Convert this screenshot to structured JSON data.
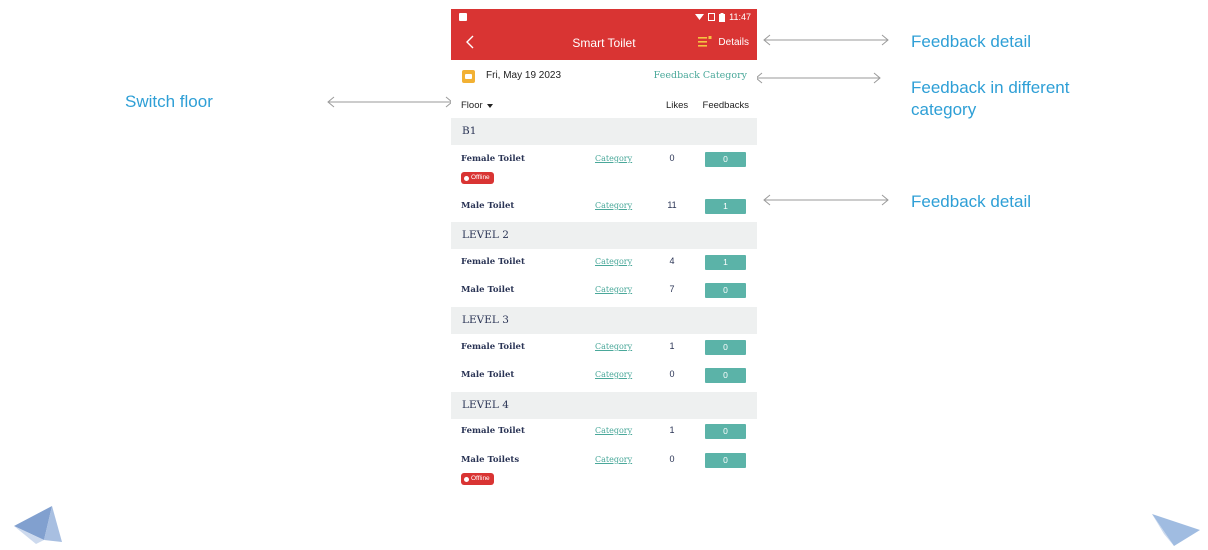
{
  "annotations": {
    "switch_floor": "Switch floor",
    "feedback_detail_top": "Feedback detail",
    "feedback_category": "Feedback in different category",
    "feedback_detail_row": "Feedback detail"
  },
  "status_bar": {
    "time": "11:47"
  },
  "app_bar": {
    "title": "Smart Toilet",
    "details_label": "Details"
  },
  "date_bar": {
    "date": "Fri, May 19 2023",
    "feedback_category_link": "Feedback Category"
  },
  "table_header": {
    "floor_label": "Floor",
    "likes_label": "Likes",
    "feedbacks_label": "Feedbacks"
  },
  "floors": [
    {
      "name": "B1",
      "toilets": [
        {
          "name": "Female Toilet",
          "category": "Category",
          "likes": "0",
          "feedbacks": "0",
          "badge": "Offline"
        },
        {
          "name": "Male Toilet",
          "category": "Category",
          "likes": "11",
          "feedbacks": "1"
        }
      ]
    },
    {
      "name": "LEVEL 2",
      "toilets": [
        {
          "name": "Female Toilet",
          "category": "Category",
          "likes": "4",
          "feedbacks": "1"
        },
        {
          "name": "Male Toilet",
          "category": "Category",
          "likes": "7",
          "feedbacks": "0"
        }
      ]
    },
    {
      "name": "LEVEL 3",
      "toilets": [
        {
          "name": "Female Toilet",
          "category": "Category",
          "likes": "1",
          "feedbacks": "0"
        },
        {
          "name": "Male Toilet",
          "category": "Category",
          "likes": "0",
          "feedbacks": "0"
        }
      ]
    },
    {
      "name": "LEVEL 4",
      "toilets": [
        {
          "name": "Female Toilet",
          "category": "Category",
          "likes": "1",
          "feedbacks": "0"
        },
        {
          "name": "Male Toilets",
          "category": "Category",
          "likes": "0",
          "feedbacks": "0",
          "badge": "Offline"
        }
      ]
    }
  ],
  "colors": {
    "app_bar": "#d93433",
    "accent": "#4aa89a",
    "feedback_button": "#5bb3a8",
    "annotation": "#2e9fd6"
  }
}
